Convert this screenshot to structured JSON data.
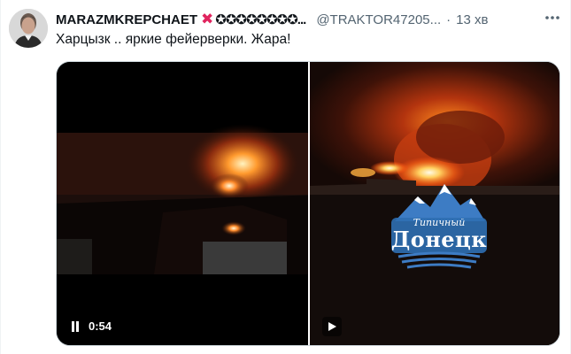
{
  "tweet": {
    "display_name": "MARAZMKREPCHAET",
    "name_symbols": "✖",
    "name_icons": "✪✪✪✪✪✪✪✪...",
    "handle": "@TRAKTOR47205...",
    "separator": "·",
    "time": "13 хв",
    "text": "Харцызк .. яркие фейерверки. Жара!",
    "more_icon": "more-horizontal-icon"
  },
  "media": {
    "video1": {
      "duration": "0:54",
      "state": "playing"
    },
    "video2": {
      "state": "paused"
    },
    "watermark": {
      "line1": "Типичный",
      "line2": "Донецк"
    }
  },
  "colors": {
    "accent_red": "#e0245e",
    "muted": "#536471",
    "border": "#cfd9de",
    "watermark_blue": "#2f6fb3"
  }
}
